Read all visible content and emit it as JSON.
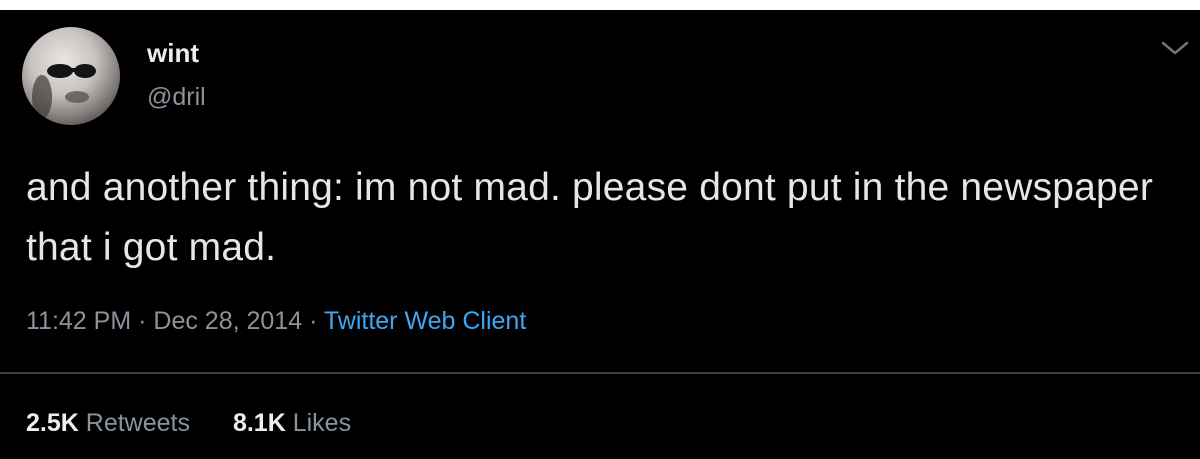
{
  "author": {
    "display_name": "wint",
    "handle": "@dril",
    "avatar_icon": "user-avatar-photo"
  },
  "tweet": {
    "text": "and another thing: im not mad. please dont put in the newspaper that i got mad.",
    "time": "11:42 PM",
    "separator": "·",
    "date": "Dec 28, 2014",
    "client": "Twitter Web Client"
  },
  "stats": {
    "retweets_count": "2.5K",
    "retweets_label": "Retweets",
    "likes_count": "8.1K",
    "likes_label": "Likes"
  },
  "menu": {
    "icon": "chevron-down-icon"
  },
  "colors": {
    "background": "#000000",
    "text": "#e6e6e6",
    "muted": "#8a939b",
    "link": "#3ea6f2"
  }
}
